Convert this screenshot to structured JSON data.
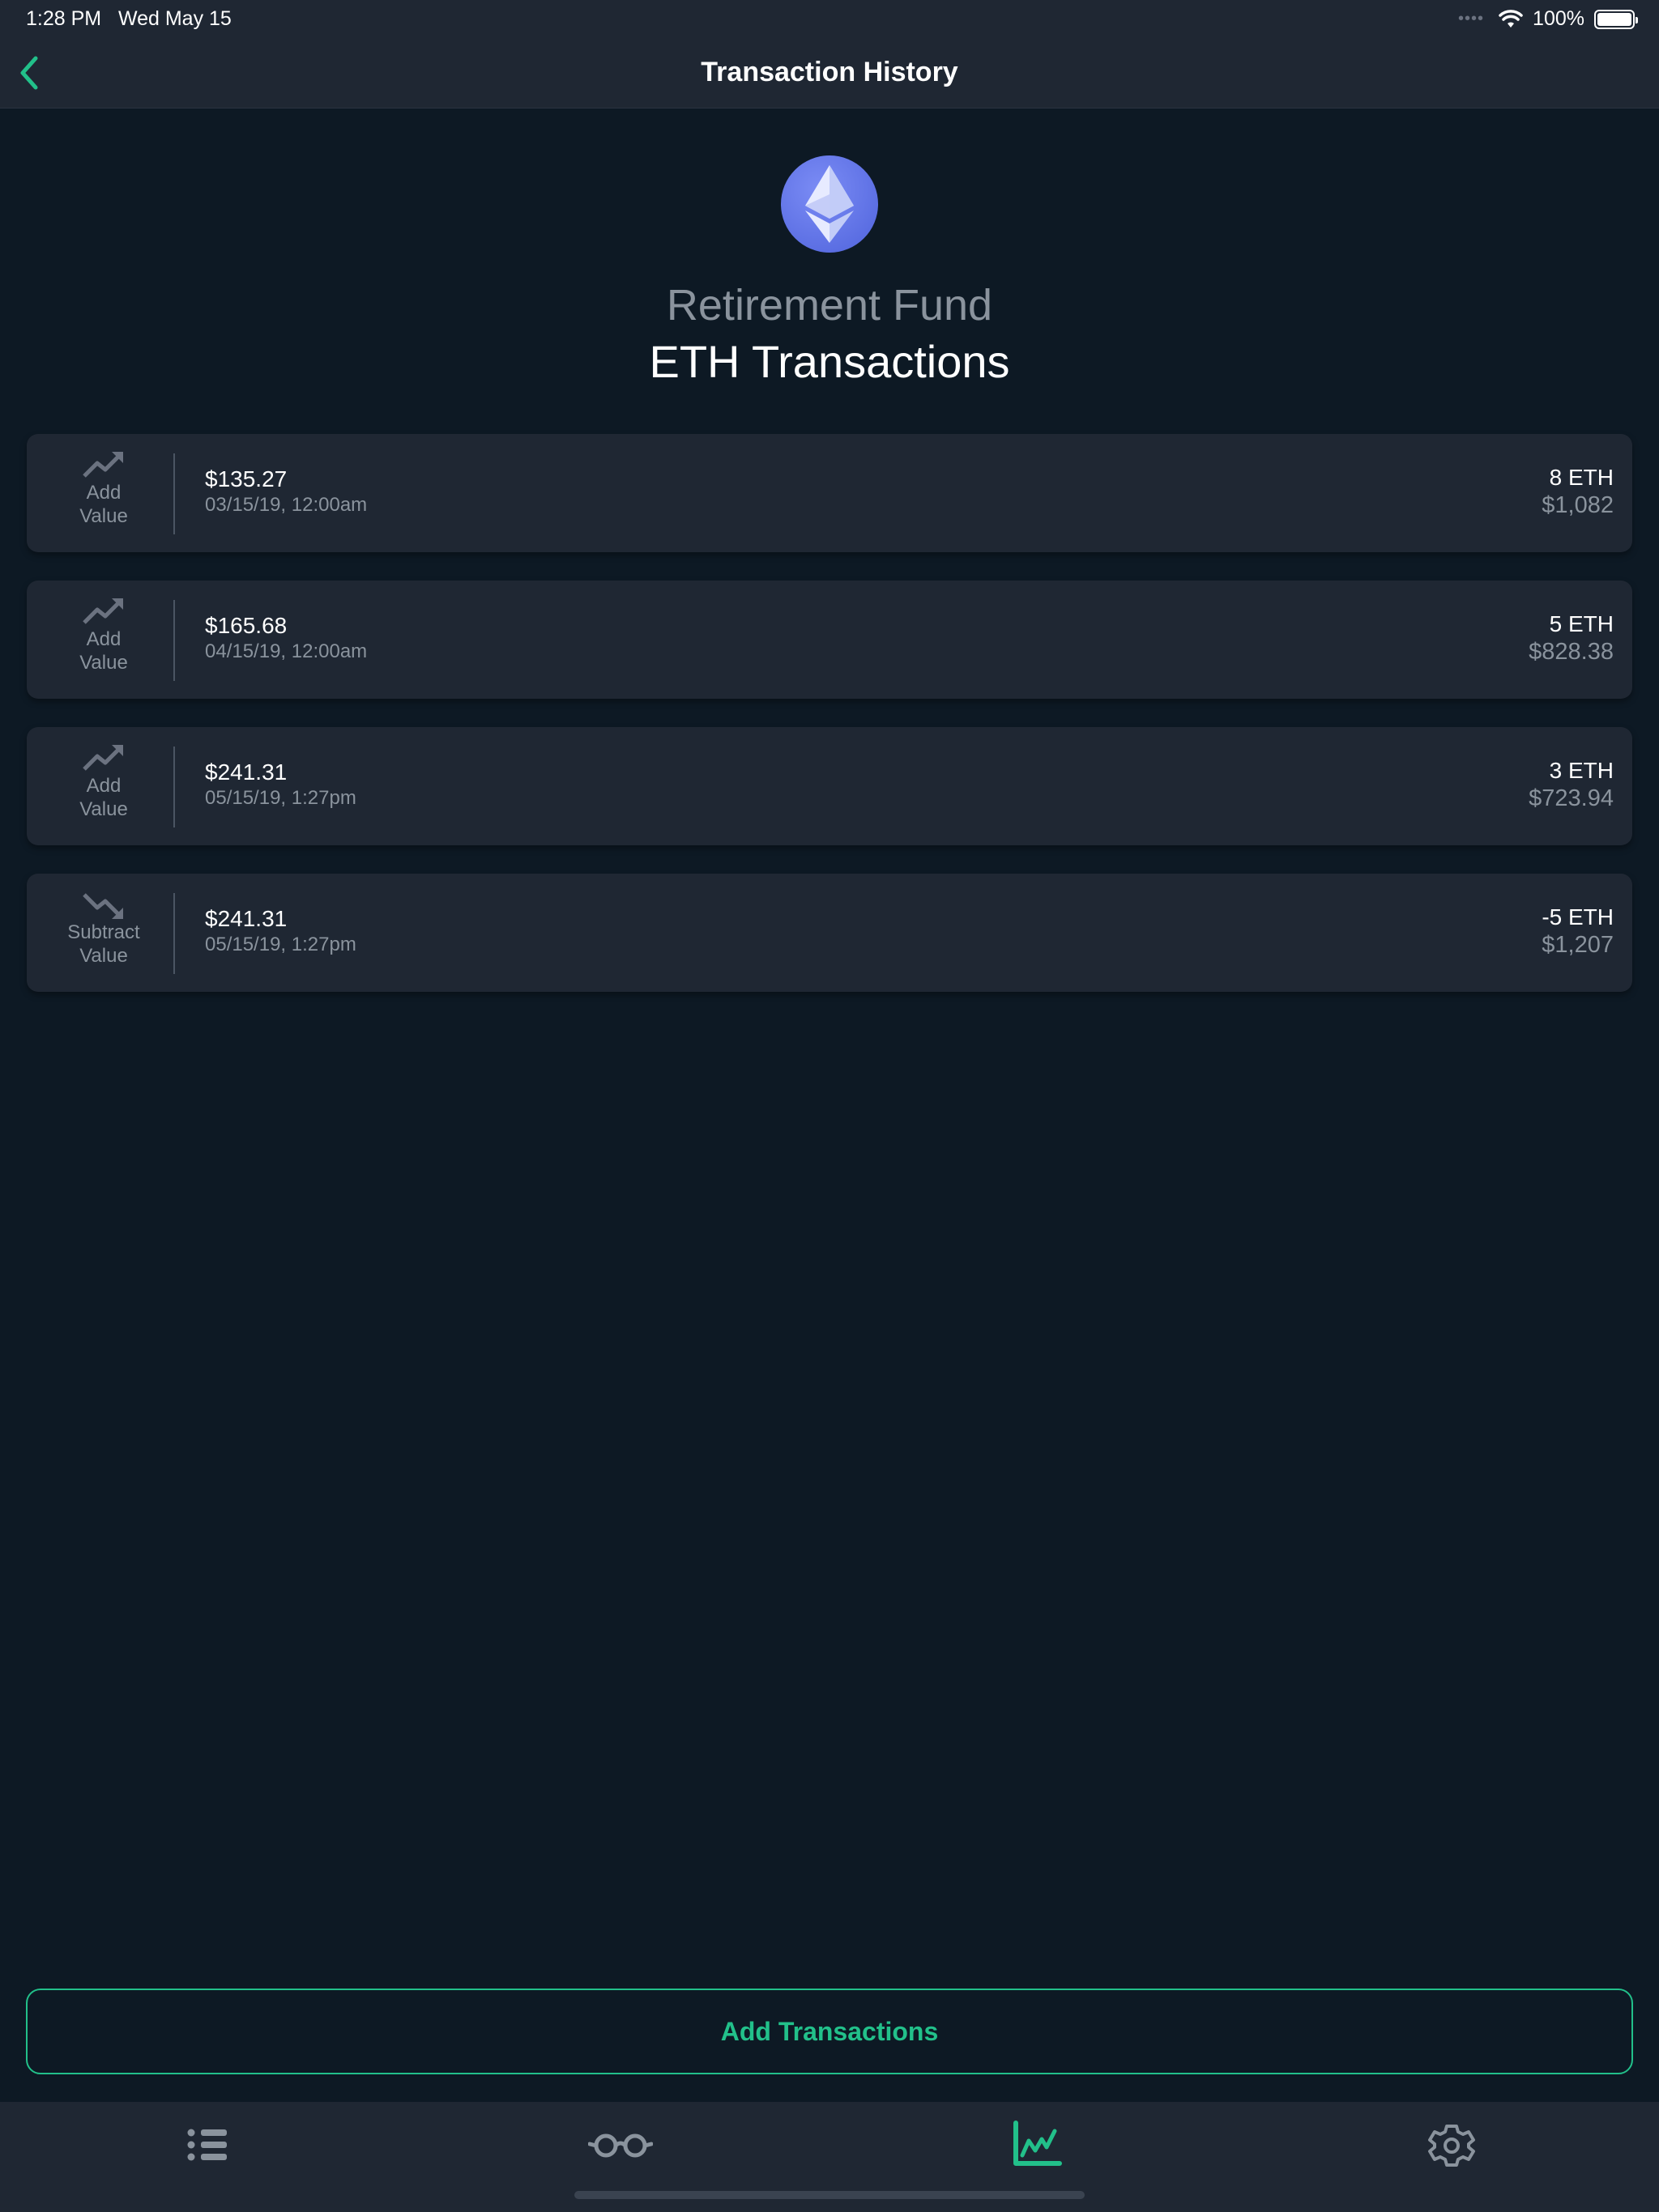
{
  "status_bar": {
    "time": "1:28 PM",
    "date": "Wed May 15",
    "battery": "100%"
  },
  "nav": {
    "title": "Transaction History",
    "accent_color": "#22c08a"
  },
  "header": {
    "portfolio": "Retirement Fund",
    "subtitle": "ETH Transactions",
    "coin_icon": "ethereum-icon"
  },
  "transactions": [
    {
      "type_line1": "Add",
      "type_line2": "Value",
      "icon": "trending-up-icon",
      "amount": "$135.27",
      "date": "03/15/19, 12:00am",
      "quantity": "8 ETH",
      "value": "$1,082"
    },
    {
      "type_line1": "Add",
      "type_line2": "Value",
      "icon": "trending-up-icon",
      "amount": "$165.68",
      "date": "04/15/19, 12:00am",
      "quantity": "5 ETH",
      "value": "$828.38"
    },
    {
      "type_line1": "Add",
      "type_line2": "Value",
      "icon": "trending-up-icon",
      "amount": "$241.31",
      "date": "05/15/19, 1:27pm",
      "quantity": "3 ETH",
      "value": "$723.94"
    },
    {
      "type_line1": "Subtract",
      "type_line2": "Value",
      "icon": "trending-down-icon",
      "amount": "$241.31",
      "date": "05/15/19, 1:27pm",
      "quantity": "-5 ETH",
      "value": "$1,207"
    }
  ],
  "add_button": {
    "label": "Add Transactions"
  },
  "tabbar": {
    "tabs": [
      {
        "icon": "list-icon",
        "active": false
      },
      {
        "icon": "glasses-icon",
        "active": false
      },
      {
        "icon": "chart-icon",
        "active": true
      },
      {
        "icon": "gear-icon",
        "active": false
      }
    ]
  }
}
